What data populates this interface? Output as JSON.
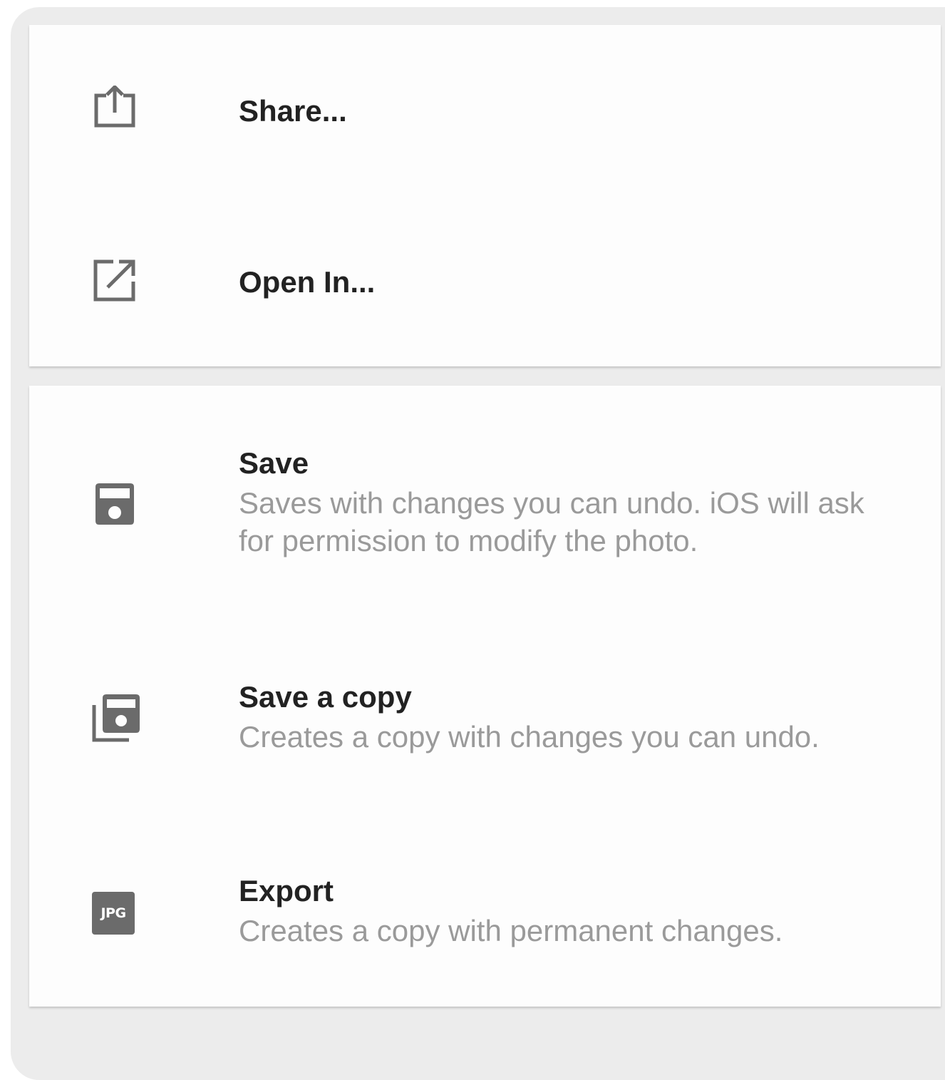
{
  "menu": {
    "share": {
      "label": "Share...",
      "icon": "share-icon"
    },
    "open_in": {
      "label": "Open In...",
      "icon": "open-external-icon"
    },
    "save": {
      "label": "Save",
      "description": "Saves with changes you can undo. iOS will ask for permission to modify the photo.",
      "icon": "save-icon"
    },
    "save_copy": {
      "label": "Save a copy",
      "description": "Creates a copy with changes you can undo.",
      "icon": "save-copy-icon"
    },
    "export": {
      "label": "Export",
      "description": "Creates a copy with permanent changes.",
      "icon": "jpg-icon",
      "icon_text": "JPG"
    }
  },
  "colors": {
    "background": "#ececec",
    "card": "#fdfdfd",
    "icon": "#6b6b6b",
    "title": "#222222",
    "description": "#9a9a9a"
  }
}
